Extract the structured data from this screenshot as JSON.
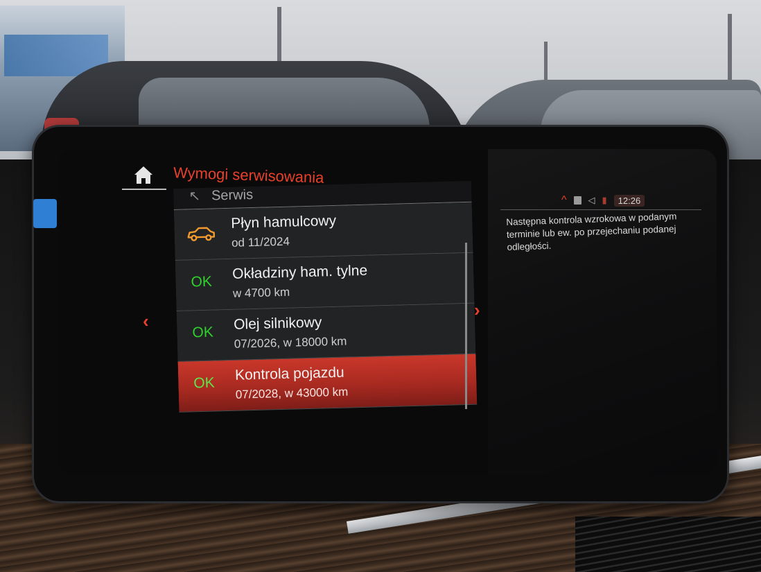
{
  "header": {
    "title": "Wymogi serwisowania",
    "breadcrumb": "Serwis"
  },
  "service_items": [
    {
      "status_type": "car-icon",
      "title": "Płyn hamulcowy",
      "detail": "od 11/2024"
    },
    {
      "status_type": "ok",
      "status": "OK",
      "title": "Okładziny ham. tylne",
      "detail": "w 4700 km"
    },
    {
      "status_type": "ok",
      "status": "OK",
      "title": "Olej silnikowy",
      "detail": "07/2026, w 18000 km"
    },
    {
      "status_type": "ok",
      "status": "OK",
      "title": "Kontrola pojazdu",
      "detail": "07/2028, w 43000 km",
      "selected": true
    }
  ],
  "info_panel": {
    "description": "Następna kontrola wzrokowa w podanym terminie lub ew. po przejechaniu podanej odległości."
  },
  "status_bar": {
    "time": "12:26"
  },
  "colors": {
    "accent": "#e8402b",
    "ok_green": "#2fd22b",
    "warning_orange": "#f29a2e",
    "selected_row": "#b02c22"
  },
  "icons": {
    "home": "home-icon",
    "nav_left": "chevron-left-icon",
    "nav_right": "chevron-right-icon",
    "brake_fluid_status": "car-icon",
    "collapse": "chevron-up-icon"
  }
}
